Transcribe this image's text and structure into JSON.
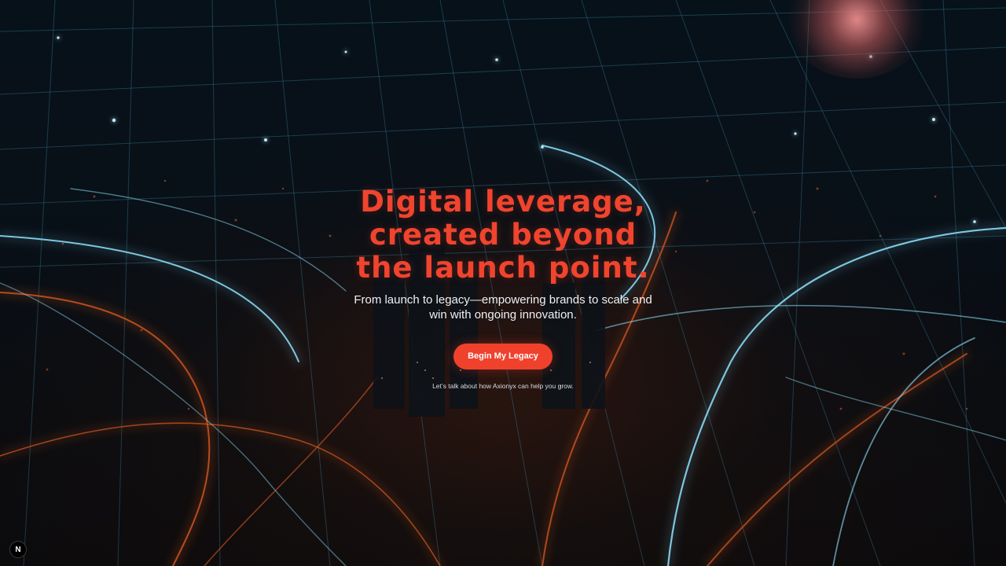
{
  "hero": {
    "headline": "Digital leverage, created beyond the launch point.",
    "subheadline": "From launch to legacy—empowering brands to scale and win with ongoing innovation.",
    "cta_label": "Begin My Legacy",
    "caption": "Let’s talk about how Axionyx can help you grow."
  },
  "dev_badge": {
    "letter": "N"
  },
  "colors": {
    "accent": "#f0442e",
    "background": "#04070c",
    "grid_line": "#4fb6d8",
    "city_lights": "#d9652a"
  },
  "icons": {
    "dev_badge": "nextjs-logo-icon"
  }
}
